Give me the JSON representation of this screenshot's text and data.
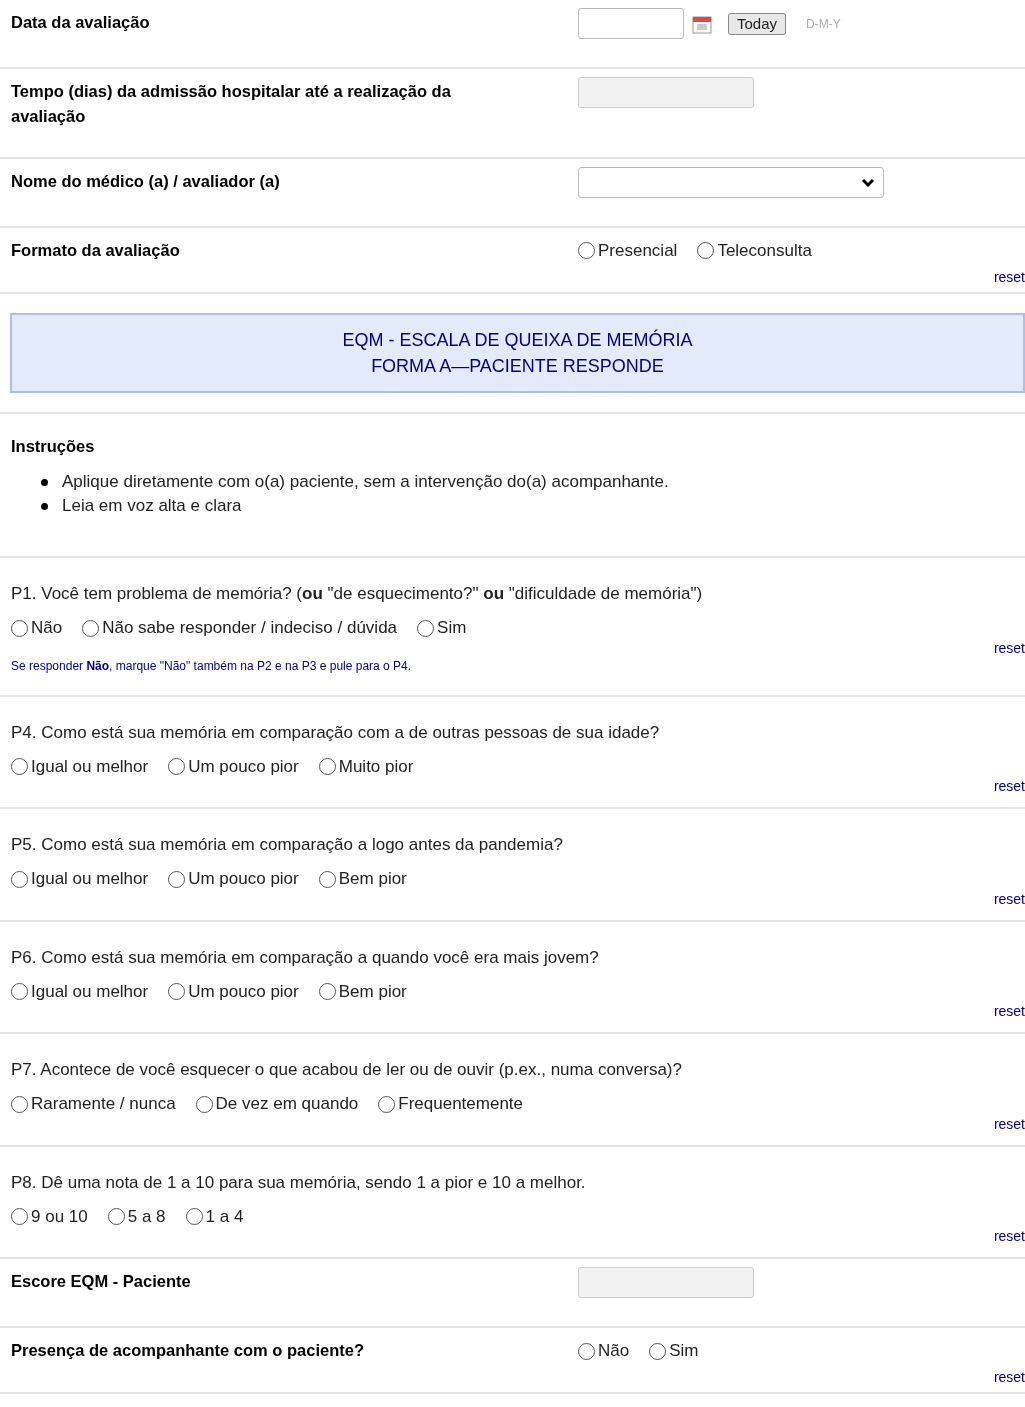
{
  "fields_top": [
    {
      "kind": "date",
      "label": "Data da avaliação",
      "button": "Today",
      "format": "D-M-Y"
    },
    {
      "kind": "calc",
      "label": "Tempo (dias) da admissão hospitalar até a realização da avaliação"
    },
    {
      "kind": "select",
      "label": "Nome do médico (a) / avaliador (a)"
    },
    {
      "kind": "radio",
      "label": "Formato da avaliação",
      "options": [
        {
          "label": "Presencial",
          "selected": false
        },
        {
          "label": "Teleconsulta",
          "selected": false
        }
      ],
      "reset": "reset"
    }
  ],
  "header": {
    "lines": [
      "EQM - ESCALA DE QUEIXA DE MEMÓRIA",
      "FORMA A—PACIENTE RESPONDE"
    ]
  },
  "instructions": {
    "title": "Instruções",
    "items": [
      "Aplique diretamente com o(a) paciente, sem a intervenção do(a) acompanhante.",
      "Leia em voz alta e clara"
    ]
  },
  "questions": [
    {
      "text": "P1. Você tem problema de memória? (**ou** \"de esquecimento?\" **ou** \"dificuldade de memória\")",
      "options": [
        {
          "label": "Não",
          "selected": false
        },
        {
          "label": "Não sabe responder / indeciso / dúvida",
          "selected": false
        },
        {
          "label": "Sim",
          "selected": false
        }
      ],
      "reset": "reset",
      "note": "Se responder **Não**, marque \"Não\" também na P2 e na P3 e pule para o P4."
    },
    {
      "text": "P4. Como está sua memória em comparação com a de outras pessoas de sua idade?",
      "options": [
        {
          "label": "Igual ou melhor",
          "selected": false
        },
        {
          "label": "Um pouco pior",
          "selected": false
        },
        {
          "label": "Muito pior",
          "selected": false
        }
      ],
      "reset": "reset"
    },
    {
      "text": "P5. Como está sua memória em comparação a logo antes da pandemia?",
      "options": [
        {
          "label": "Igual ou melhor",
          "selected": false
        },
        {
          "label": "Um pouco pior",
          "selected": false
        },
        {
          "label": "Bem pior",
          "selected": false
        }
      ],
      "reset": "reset"
    },
    {
      "text": "P6. Como está sua memória em comparação a quando você era mais jovem?",
      "options": [
        {
          "label": "Igual ou melhor",
          "selected": false
        },
        {
          "label": "Um pouco pior",
          "selected": false
        },
        {
          "label": "Bem pior",
          "selected": false
        }
      ],
      "reset": "reset"
    },
    {
      "text": "P7. Acontece de você esquecer o que acabou de ler ou de ouvir (p.ex., numa conversa)?",
      "options": [
        {
          "label": "Raramente / nunca",
          "selected": false
        },
        {
          "label": "De vez em quando",
          "selected": false
        },
        {
          "label": "Frequentemente",
          "selected": false
        }
      ],
      "reset": "reset"
    },
    {
      "text": "P8. Dê uma nota de 1 a 10 para sua memória, sendo 1 a pior e 10 a melhor.",
      "options": [
        {
          "label": "9 ou 10",
          "selected": false
        },
        {
          "label": "5 a 8",
          "selected": false
        },
        {
          "label": "1 a 4",
          "selected": false
        }
      ],
      "reset": "reset"
    }
  ],
  "fields_bottom": [
    {
      "kind": "calc",
      "label": "Escore EQM - Paciente"
    },
    {
      "kind": "radio",
      "label": "Presença de acompanhante com o paciente?",
      "options": [
        {
          "label": "Não",
          "selected": false
        },
        {
          "label": "Sim",
          "selected": false
        }
      ],
      "reset": "reset"
    }
  ]
}
